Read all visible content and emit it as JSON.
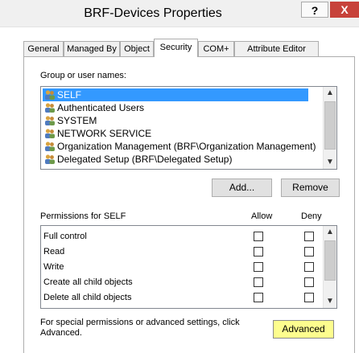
{
  "window": {
    "title": "BRF-Devices Properties",
    "help_label": "?",
    "close_label": "X"
  },
  "tabs": [
    {
      "label": "General"
    },
    {
      "label": "Managed By"
    },
    {
      "label": "Object"
    },
    {
      "label": "Security"
    },
    {
      "label": "COM+"
    },
    {
      "label": "Attribute Editor"
    }
  ],
  "active_tab": "Security",
  "security": {
    "users_label": "Group or user names:",
    "users": [
      {
        "name": "SELF"
      },
      {
        "name": "Authenticated Users"
      },
      {
        "name": "SYSTEM"
      },
      {
        "name": "NETWORK SERVICE"
      },
      {
        "name": "Organization Management (BRF\\Organization Management)"
      },
      {
        "name": "Delegated Setup (BRF\\Delegated Setup)"
      }
    ],
    "selected_user": "SELF",
    "add_label": "Add...",
    "remove_label": "Remove",
    "permissions_label": "Permissions for SELF",
    "allow_label": "Allow",
    "deny_label": "Deny",
    "permissions": [
      {
        "name": "Full control",
        "allow": false,
        "deny": false
      },
      {
        "name": "Read",
        "allow": false,
        "deny": false
      },
      {
        "name": "Write",
        "allow": false,
        "deny": false
      },
      {
        "name": "Create all child objects",
        "allow": false,
        "deny": false
      },
      {
        "name": "Delete all child objects",
        "allow": false,
        "deny": false
      }
    ],
    "special_text_line1": "For special permissions or advanced settings, click",
    "special_text_line2": "Advanced.",
    "advanced_label": "Advanced",
    "advanced_highlight": "#fdfd8e"
  },
  "icons": {
    "user_icon": "users-group-icon",
    "scroll_up": "chevron-up-icon",
    "scroll_down": "chevron-down-icon"
  }
}
